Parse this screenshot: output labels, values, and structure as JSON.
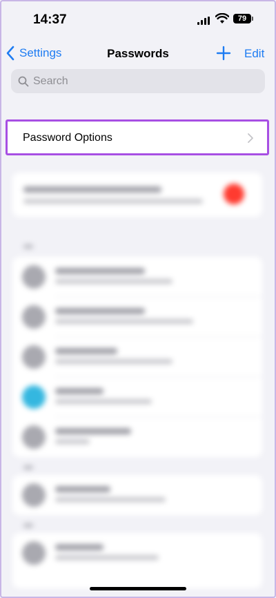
{
  "status_bar": {
    "time": "14:37",
    "battery": "79"
  },
  "nav": {
    "back_label": "Settings",
    "title": "Passwords",
    "edit_label": "Edit"
  },
  "search": {
    "placeholder": "Search"
  },
  "password_options": {
    "label": "Password Options"
  },
  "colors": {
    "accent": "#1e7cf2",
    "highlight": "#a74fe3",
    "alert": "#ff3b30"
  },
  "icons": [
    "back-chevron-icon",
    "plus-icon",
    "search-icon",
    "chevron-right-icon",
    "wifi-icon",
    "signal-icon",
    "battery-icon"
  ]
}
